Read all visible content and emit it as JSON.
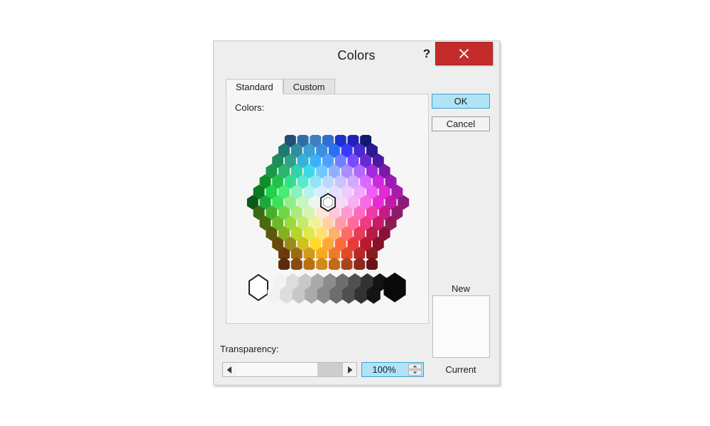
{
  "dialog": {
    "title": "Colors",
    "help_icon": "?",
    "close_icon": "close-x-icon",
    "close_bg": "#c42b2b"
  },
  "tabs": [
    {
      "label": "Standard",
      "active": true
    },
    {
      "label": "Custom",
      "active": false
    }
  ],
  "colors_group": {
    "label": "Colors:",
    "selected_hex_color": "#ffffff",
    "wheel": {
      "rows": [
        [
          "#1f4e79",
          "#2e6ea6",
          "#3f7fbf",
          "#2f6fd0",
          "#1a33cc",
          "#2222bb",
          "#101a6e"
        ],
        [
          "#1f7a6e",
          "#2f8fa0",
          "#3f9fd0",
          "#3a8fe0",
          "#2a6ff5",
          "#3a3aff",
          "#4a2ad0",
          "#2a1a8e"
        ],
        [
          "#1f8a5a",
          "#2fa08a",
          "#33b3d8",
          "#3ab0ff",
          "#4f9fff",
          "#6f7fff",
          "#7a4aff",
          "#6a2ad0",
          "#4a1aa0"
        ],
        [
          "#18994a",
          "#2ab56a",
          "#35cfa8",
          "#3fd8e8",
          "#6fc8ff",
          "#8fb0ff",
          "#a88fff",
          "#b06aff",
          "#a32adc",
          "#7a1aa8"
        ],
        [
          "#0f8f2a",
          "#22c04a",
          "#2fe08a",
          "#5ae8cf",
          "#8fe4f5",
          "#b8daff",
          "#c9c2ff",
          "#d3a8ff",
          "#d76aff",
          "#cc2ae0",
          "#9a1ab4"
        ],
        [
          "#0c7a22",
          "#1fd24a",
          "#48ef6f",
          "#86f2bd",
          "#b6f2ef",
          "#d8ecff",
          "#e2e0ff",
          "#ebccff",
          "#f0a8ff",
          "#ee5cf5",
          "#e02ad6",
          "#a81aa8"
        ],
        [
          "#0a5a1a",
          "#1aa83a",
          "#3ee05a",
          "#8ff08a",
          "#c6f5c0",
          "#eef6f2",
          "#ffffff",
          "#f7d8f5",
          "#f9b0f2",
          "#f86ae8",
          "#e82ad0",
          "#c21aa8",
          "#8e1a7a"
        ],
        [
          "#3a6a14",
          "#46b02a",
          "#6fd84a",
          "#a8ee7a",
          "#d4f5b0",
          "#fde6d8",
          "#ffc8d8",
          "#ff9ad0",
          "#ff6ac0",
          "#f03aa8",
          "#c81a8e",
          "#8e1a6e"
        ],
        [
          "#4a6a10",
          "#6cb82a",
          "#9ada3a",
          "#c6ea6a",
          "#f2f09a",
          "#ffd0a8",
          "#ff9aa8",
          "#ff6a9a",
          "#f03a80",
          "#c81a68",
          "#8e1a54"
        ],
        [
          "#5a5a0c",
          "#86b020",
          "#b8d42a",
          "#e0e84a",
          "#ffe06a",
          "#ffb06a",
          "#ff6a6a",
          "#e83a5a",
          "#b81a4a",
          "#8a1038"
        ],
        [
          "#6a4a0c",
          "#9a8a1a",
          "#d0c020",
          "#ffd82a",
          "#ffa83a",
          "#ff6a3a",
          "#e83a3a",
          "#b81a34",
          "#8a1028"
        ],
        [
          "#6a3a0c",
          "#9a6a14",
          "#d09a1a",
          "#f8a820",
          "#f07a2a",
          "#e04a2a",
          "#b82a2a",
          "#8a1a22"
        ],
        [
          "#5a2a0c",
          "#8a4a10",
          "#b87014",
          "#d08a18",
          "#c06a1a",
          "#a8441a",
          "#8a2a1a",
          "#6a1418"
        ]
      ]
    },
    "gray_row": {
      "white_hexagon": "#ffffff",
      "gradient": [
        "#f2f2f2",
        "#dddddd",
        "#c8c8c8",
        "#aaaaaa",
        "#8c8c8c",
        "#6e6e6e",
        "#505050",
        "#323232",
        "#141414"
      ],
      "black_hexagon": "#0a0a0a"
    }
  },
  "transparency": {
    "label": "Transparency:",
    "left_arrow_icon": "triangle-left-icon",
    "right_arrow_icon": "triangle-right-icon",
    "value": "100%",
    "spin_up_icon": "triangle-up-icon",
    "spin_down_icon": "triangle-down-icon",
    "thumb_position_percent": 100
  },
  "buttons": {
    "ok": "OK",
    "cancel": "Cancel",
    "ok_bg": "#aee4f5",
    "ok_border": "#3d9fd0"
  },
  "preview": {
    "new_label": "New",
    "current_label": "Current",
    "new_color": "#fbfbfb",
    "current_color": "#fbfbfb"
  }
}
